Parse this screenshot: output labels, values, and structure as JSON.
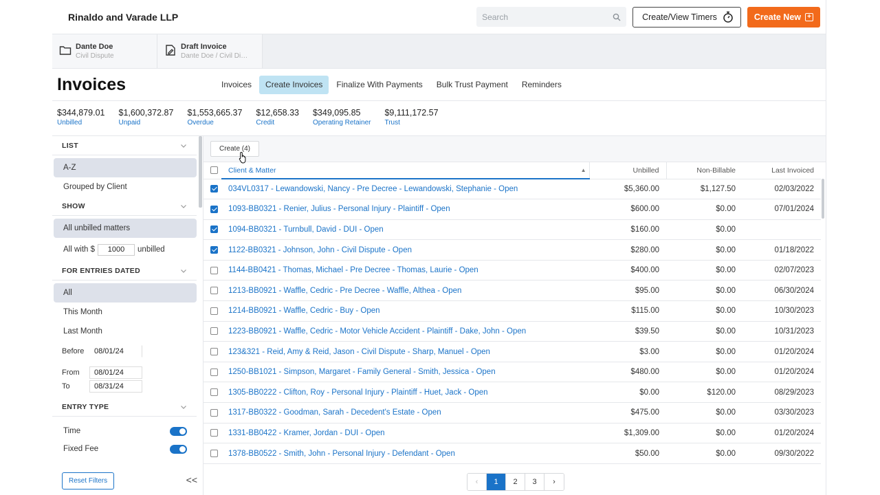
{
  "header": {
    "brand": "Rinaldo and Varade LLP",
    "search_placeholder": "Search",
    "timer_label": "Create/View Timers",
    "create_new_label": "Create New"
  },
  "recent": [
    {
      "title": "Dante Doe",
      "subtitle": "Civil Dispute",
      "icon": "folder-icon"
    },
    {
      "title": "Draft Invoice",
      "subtitle": "Dante Doe / Civil Dis...",
      "icon": "edit-document-icon"
    }
  ],
  "page": {
    "title": "Invoices",
    "tabs": [
      "Invoices",
      "Create Invoices",
      "Finalize With Payments",
      "Bulk Trust Payment",
      "Reminders"
    ],
    "active_tab": "Create Invoices"
  },
  "stats": [
    {
      "value": "$344,879.01",
      "label": "Unbilled"
    },
    {
      "value": "$1,600,372.87",
      "label": "Unpaid"
    },
    {
      "value": "$1,553,665.37",
      "label": "Overdue"
    },
    {
      "value": "$12,658.33",
      "label": "Credit"
    },
    {
      "value": "$349,095.85",
      "label": "Operating Retainer"
    },
    {
      "value": "$9,111,172.57",
      "label": "Trust"
    }
  ],
  "sidebar": {
    "list_head": "LIST",
    "list_opts": [
      "A-Z",
      "Grouped by Client"
    ],
    "show_head": "SHOW",
    "show_opt1": "All unbilled matters",
    "show_opt2_prefix": "All with $",
    "show_opt2_value": "1000",
    "show_opt2_suffix": "unbilled",
    "dated_head": "FOR ENTRIES DATED",
    "dated_opts": [
      "All",
      "This Month",
      "Last Month"
    ],
    "before_label": "Before",
    "before_value": "08/01/24",
    "from_label": "From",
    "from_value": "08/01/24",
    "to_label": "To",
    "to_value": "08/31/24",
    "entry_head": "ENTRY TYPE",
    "entry_types": [
      "Time",
      "Fixed Fee"
    ],
    "reset_label": "Reset Filters",
    "collapse_label": "<<"
  },
  "toolbar": {
    "create_label": "Create (4)"
  },
  "table": {
    "headers": [
      "Client & Matter",
      "Unbilled",
      "Non-Billable",
      "Last Invoiced"
    ],
    "rows": [
      {
        "checked": true,
        "matter": "034VL0317 - Lewandowski, Nancy - Pre Decree - Lewandowski, Stephanie - Open",
        "unbilled": "$5,360.00",
        "nonbill": "$1,127.50",
        "last": "02/03/2022"
      },
      {
        "checked": true,
        "matter": "1093-BB0321 - Renier, Julius - Personal Injury - Plaintiff - Open",
        "unbilled": "$600.00",
        "nonbill": "$0.00",
        "last": "07/01/2024"
      },
      {
        "checked": true,
        "matter": "1094-BB0321 - Turnbull, David - DUI - Open",
        "unbilled": "$160.00",
        "nonbill": "$0.00",
        "last": ""
      },
      {
        "checked": true,
        "matter": "1122-BB0321 - Johnson, John - Civil Dispute - Open",
        "unbilled": "$280.00",
        "nonbill": "$0.00",
        "last": "01/18/2022"
      },
      {
        "checked": false,
        "matter": "1144-BB0421 - Thomas, Michael - Pre Decree - Thomas, Laurie - Open",
        "unbilled": "$400.00",
        "nonbill": "$0.00",
        "last": "02/07/2023"
      },
      {
        "checked": false,
        "matter": "1213-BB0921 - Waffle, Cedric - Pre Decree - Waffle, Althea - Open",
        "unbilled": "$95.00",
        "nonbill": "$0.00",
        "last": "06/30/2024"
      },
      {
        "checked": false,
        "matter": "1214-BB0921 - Waffle, Cedric - Buy - Open",
        "unbilled": "$115.00",
        "nonbill": "$0.00",
        "last": "10/30/2023"
      },
      {
        "checked": false,
        "matter": "1223-BB0921 - Waffle, Cedric - Motor Vehicle Accident - Plaintiff - Dake, John - Open",
        "unbilled": "$39.50",
        "nonbill": "$0.00",
        "last": "10/31/2023"
      },
      {
        "checked": false,
        "matter": "123&321 - Reid, Amy & Reid, Jason - Civil Dispute - Sharp, Manuel - Open",
        "unbilled": "$3.00",
        "nonbill": "$0.00",
        "last": "01/20/2024"
      },
      {
        "checked": false,
        "matter": "1250-BB1021 - Simpson, Margaret - Family General - Smith, Jessica - Open",
        "unbilled": "$480.00",
        "nonbill": "$0.00",
        "last": "01/20/2024"
      },
      {
        "checked": false,
        "matter": "1305-BB0222 - Clifton, Roy - Personal Injury - Plaintiff - Huet, Jack - Open",
        "unbilled": "$0.00",
        "nonbill": "$120.00",
        "last": "08/29/2023"
      },
      {
        "checked": false,
        "matter": "1317-BB0322 - Goodman, Sarah - Decedent's Estate - Open",
        "unbilled": "$475.00",
        "nonbill": "$0.00",
        "last": "03/30/2023"
      },
      {
        "checked": false,
        "matter": "1331-BB0422 - Kramer, Jordan - DUI - Open",
        "unbilled": "$1,309.00",
        "nonbill": "$0.00",
        "last": "01/20/2024"
      },
      {
        "checked": false,
        "matter": "1378-BB0522 - Smith, John - Personal Injury - Defendant - Open",
        "unbilled": "$50.00",
        "nonbill": "$0.00",
        "last": "09/30/2022"
      }
    ]
  },
  "pager": {
    "prev": "‹",
    "pages": [
      "1",
      "2",
      "3"
    ],
    "next": "›",
    "current": "1"
  }
}
